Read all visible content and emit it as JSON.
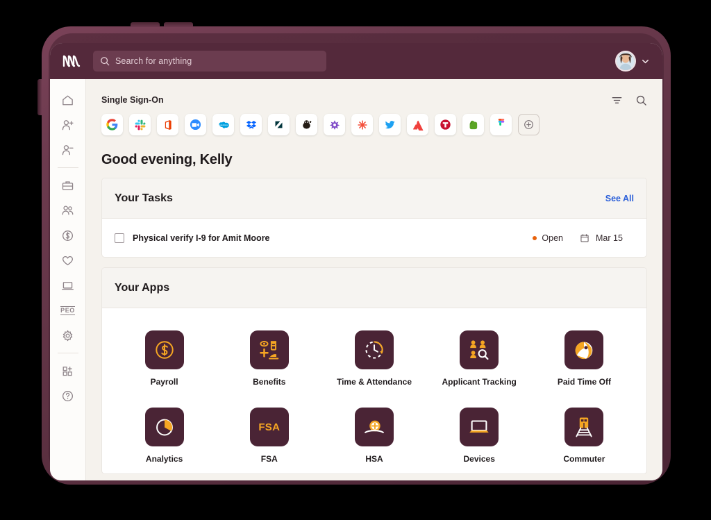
{
  "topbar": {
    "logo_name": "rippling-logo",
    "search": {
      "placeholder": "Search for anything",
      "value": "Search for anything",
      "icon": "search-icon"
    },
    "avatar_name": "user-avatar",
    "chevron": "chevron-down-icon",
    "background_color": "#54293b"
  },
  "sidebar": {
    "items": [
      {
        "name": "home",
        "icon": "home-icon",
        "label": ""
      },
      {
        "name": "add-person",
        "icon": "person-add-icon",
        "label": ""
      },
      {
        "name": "remove-person",
        "icon": "person-remove-icon",
        "label": ""
      },
      {
        "name": "briefcase",
        "icon": "briefcase-icon",
        "label": ""
      },
      {
        "name": "people",
        "icon": "people-icon",
        "label": ""
      },
      {
        "name": "payroll",
        "icon": "dollar-circle-icon",
        "label": ""
      },
      {
        "name": "benefits",
        "icon": "heart-icon",
        "label": ""
      },
      {
        "name": "devices",
        "icon": "laptop-icon",
        "label": ""
      },
      {
        "name": "peo",
        "icon": "peo-text-icon",
        "label": "PEO"
      },
      {
        "name": "settings",
        "icon": "gear-icon",
        "label": ""
      },
      {
        "name": "add-app",
        "icon": "app-add-icon",
        "label": ""
      },
      {
        "name": "help",
        "icon": "help-circle-icon",
        "label": ""
      }
    ]
  },
  "sso": {
    "title": "Single Sign-On",
    "filter_icon": "filter-icon",
    "search_icon": "search-icon",
    "apps": [
      {
        "name": "google",
        "label": "Google"
      },
      {
        "name": "slack",
        "label": "Slack"
      },
      {
        "name": "office365",
        "label": "Office 365"
      },
      {
        "name": "zoom",
        "label": "Zoom"
      },
      {
        "name": "salesforce",
        "label": "Salesforce"
      },
      {
        "name": "dropbox",
        "label": "Dropbox"
      },
      {
        "name": "zendesk",
        "label": "Zendesk"
      },
      {
        "name": "mailchimp",
        "label": "Mailchimp"
      },
      {
        "name": "gitkraken",
        "label": "GitKraken"
      },
      {
        "name": "asterisk-app",
        "label": "Asterisk"
      },
      {
        "name": "twitter",
        "label": "Twitter"
      },
      {
        "name": "atlassian",
        "label": "Atlassian"
      },
      {
        "name": "tmobile",
        "label": "T"
      },
      {
        "name": "evernote",
        "label": "Evernote"
      },
      {
        "name": "figma",
        "label": "Figma"
      }
    ],
    "add_button_label": "+"
  },
  "greeting": "Good evening, Kelly",
  "tasks_card": {
    "title": "Your Tasks",
    "see_all_label": "See All",
    "rows": [
      {
        "label": "Physical verify I-9 for Amit Moore",
        "status": "Open",
        "status_color": "#e8620c",
        "due": "Mar 15",
        "checked": false
      }
    ]
  },
  "apps_card": {
    "title": "Your Apps",
    "apps": [
      {
        "label": "Payroll",
        "icon": "dollar-circle-icon"
      },
      {
        "label": "Benefits",
        "icon": "benefits-icon"
      },
      {
        "label": "Time & Attendance",
        "icon": "clock-icon"
      },
      {
        "label": "Applicant Tracking",
        "icon": "applicant-search-icon"
      },
      {
        "label": "Paid Time Off",
        "icon": "beach-ball-icon"
      },
      {
        "label": "Analytics",
        "icon": "pie-chart-icon"
      },
      {
        "label": "FSA",
        "icon": "fsa-text-icon",
        "text": "FSA"
      },
      {
        "label": "HSA",
        "icon": "hsa-icon"
      },
      {
        "label": "Devices",
        "icon": "laptop-icon"
      },
      {
        "label": "Commuter",
        "icon": "train-icon"
      }
    ],
    "tile_color": "#4a2435",
    "accent_color": "#f5a623"
  }
}
